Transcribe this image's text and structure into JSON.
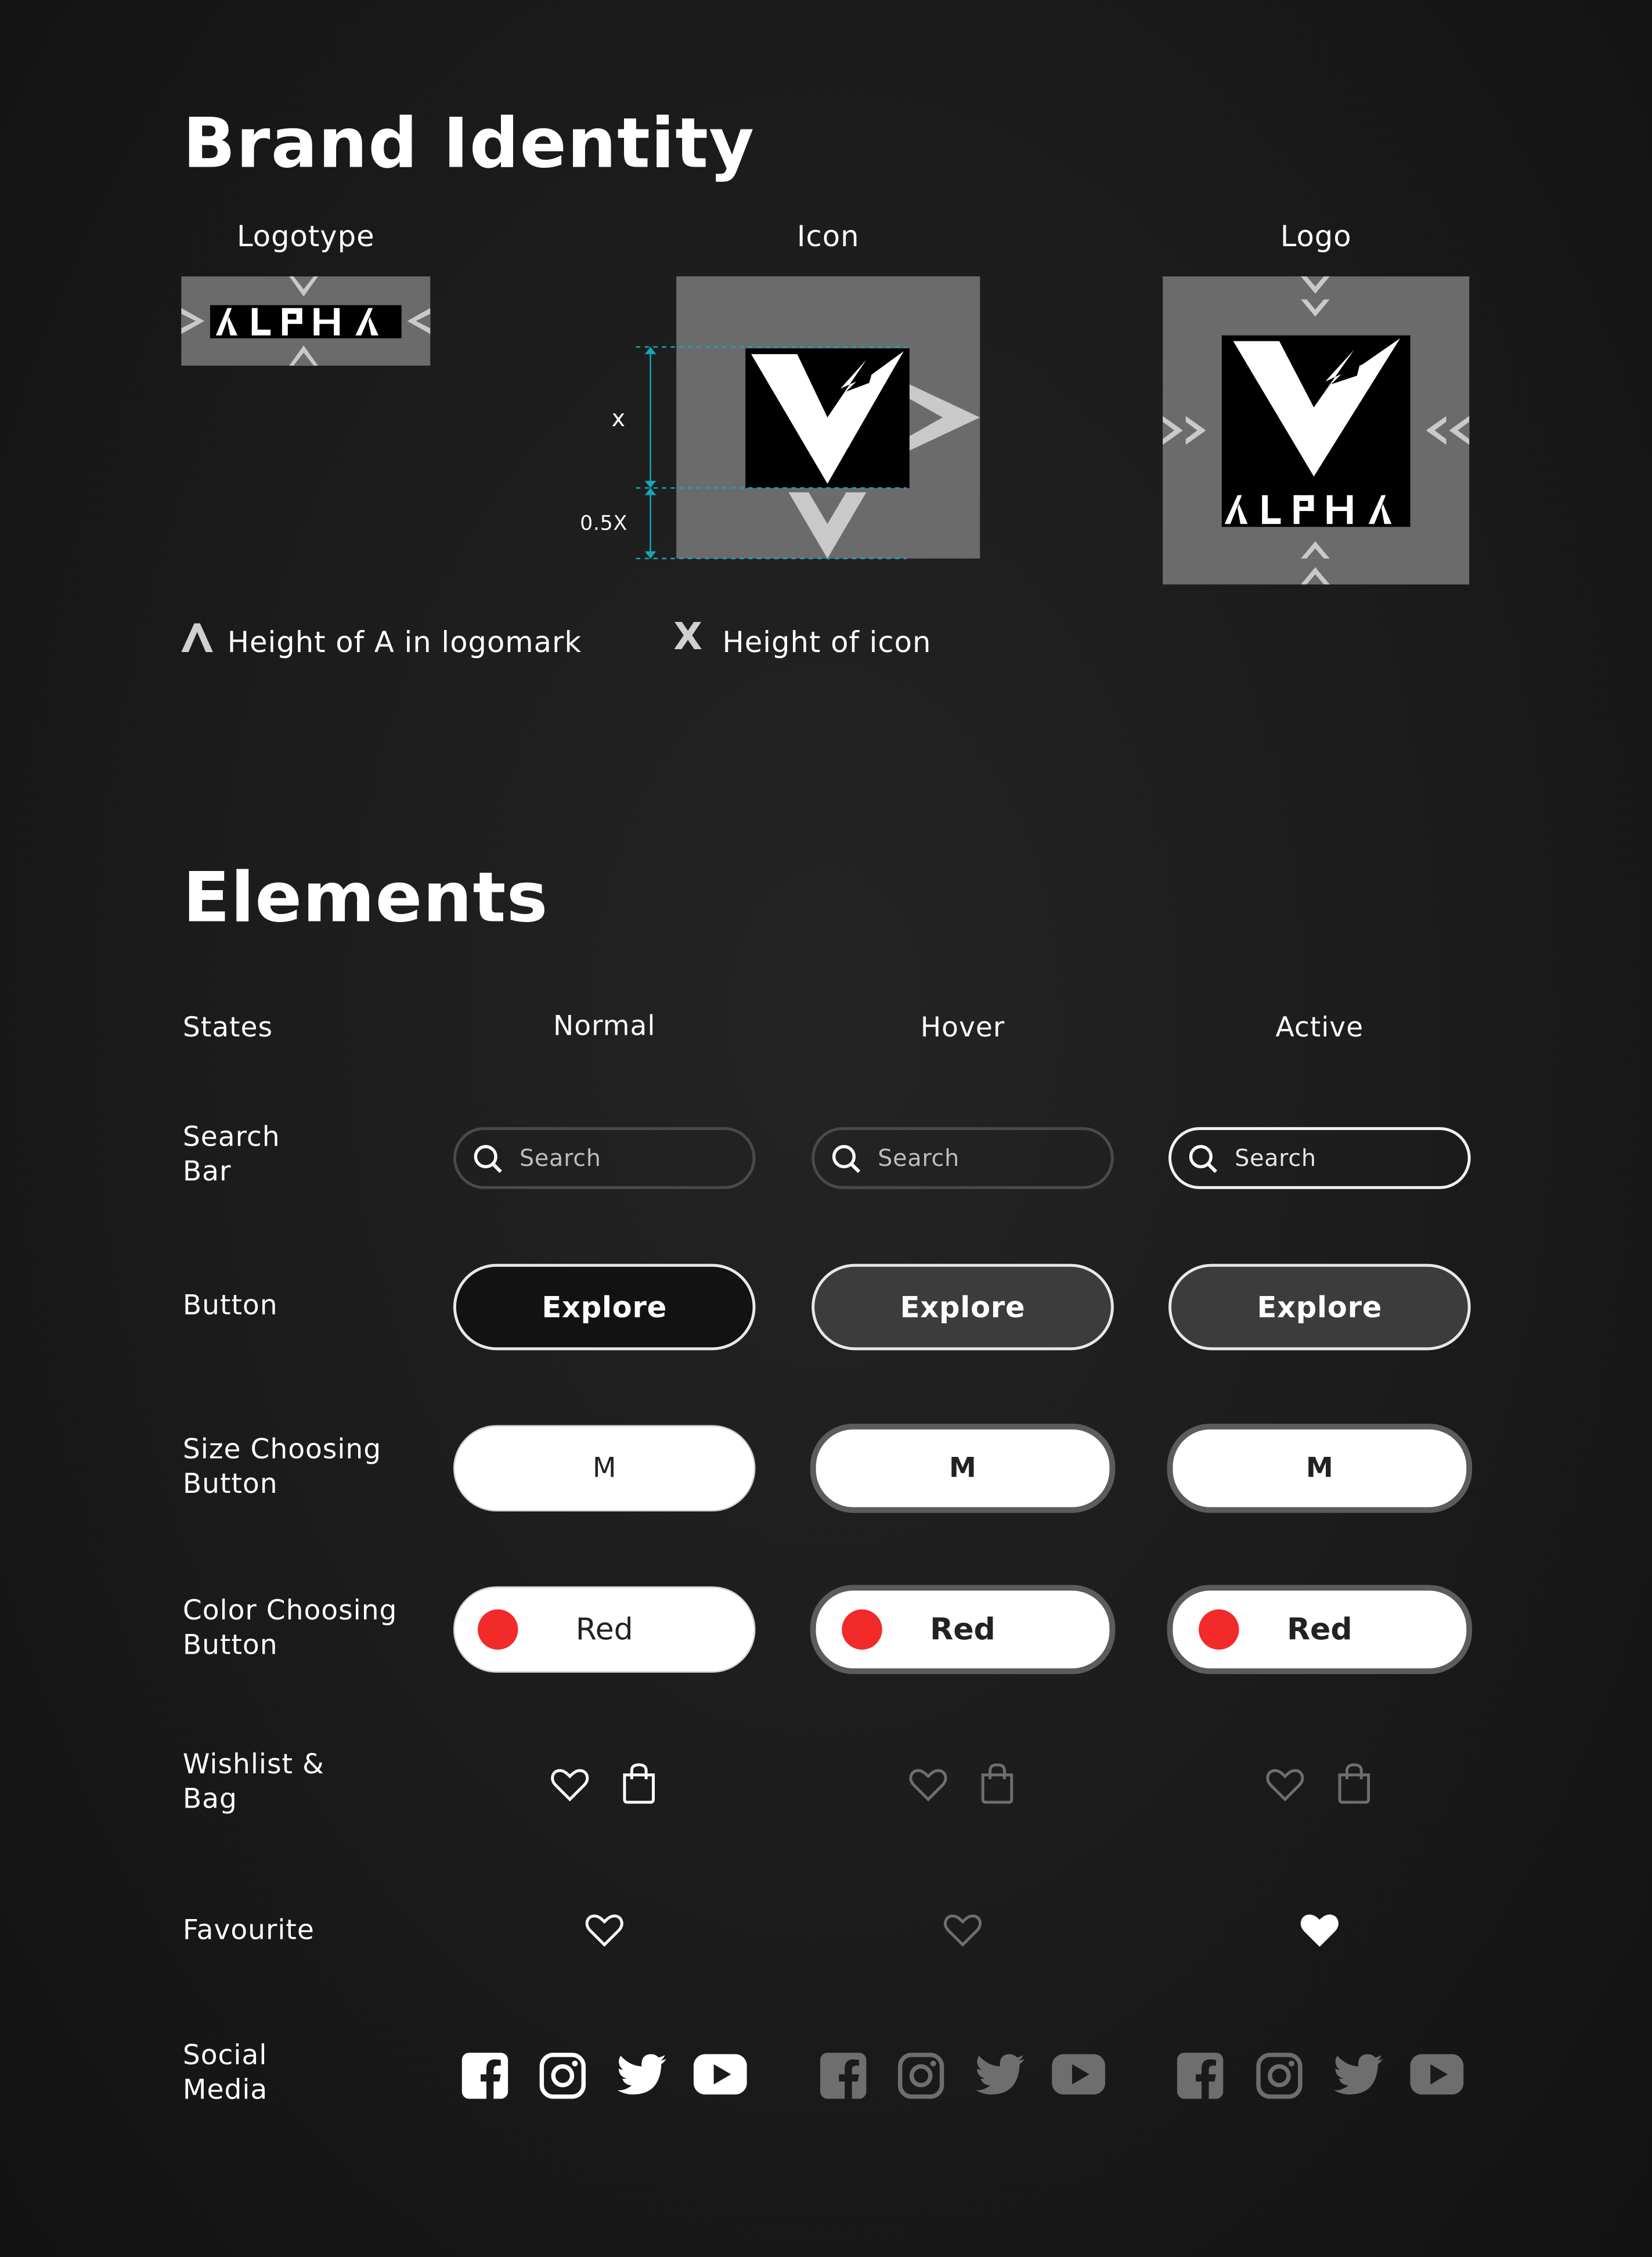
{
  "brand": {
    "title": "Brand Identity",
    "logotype_label": "Logotype",
    "icon_label": "Icon",
    "logo_label": "Logo",
    "wordmark": "ALPHA",
    "dimension_x": "x",
    "dimension_half": "0.5X",
    "legend": [
      {
        "symbol": "A-chevron-icon",
        "text": "Height of A in logomark"
      },
      {
        "symbol": "X",
        "text": "Height of icon"
      }
    ],
    "colors": {
      "panel": "#6b6b6b",
      "guide": "#16a6b6",
      "mark": "#000000"
    }
  },
  "elements": {
    "title": "Elements",
    "states_label": "States",
    "states": [
      "Normal",
      "Hover",
      "Active"
    ],
    "rows": {
      "search": {
        "label_1": "Search",
        "label_2": "Bar",
        "placeholder": "Search"
      },
      "button": {
        "label": "Button",
        "text": "Explore"
      },
      "size": {
        "label_1": "Size Choosing",
        "label_2": "Button",
        "text": "M"
      },
      "color": {
        "label_1": "Color Choosing",
        "label_2": "Button",
        "text": "Red",
        "swatch": "#f22a2a"
      },
      "wishlist": {
        "label_1": "Wishlist &",
        "label_2": "Bag",
        "icons": [
          "heart-outline-icon",
          "shopping-bag-icon"
        ]
      },
      "favourite": {
        "label": "Favourite",
        "icons": [
          "heart-outline-icon",
          "heart-outline-icon",
          "heart-filled-icon"
        ]
      },
      "social": {
        "label_1": "Social",
        "label_2": "Media",
        "icons": [
          "facebook-icon",
          "instagram-icon",
          "twitter-icon",
          "youtube-icon"
        ]
      }
    }
  }
}
